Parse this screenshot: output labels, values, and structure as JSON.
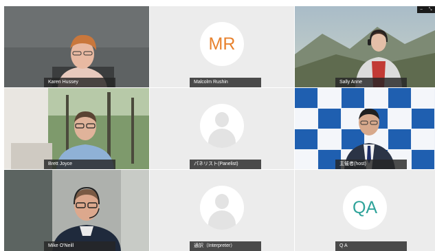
{
  "participants": [
    {
      "name": "Karen Hussey",
      "type": "video"
    },
    {
      "name": "Malcolm Rushin",
      "type": "initials",
      "initials": "MR",
      "initials_color": "#e8822e"
    },
    {
      "name": "Sally Anne",
      "type": "video"
    },
    {
      "name": "Brett Joyce",
      "type": "video"
    },
    {
      "name": "パネリスト(Panelist)",
      "type": "silhouette"
    },
    {
      "name": "主催者(host)",
      "type": "video"
    },
    {
      "name": "Mike O'Neill",
      "type": "video"
    },
    {
      "name": "通訳（Interpreter）",
      "type": "silhouette"
    },
    {
      "name": "Q A",
      "type": "initials",
      "initials": "QA",
      "initials_color": "#2fa39a"
    }
  ],
  "window_controls": {
    "minimize": "–",
    "expand": "⤡"
  },
  "colors": {
    "tile_background": "#ececec",
    "name_tag_background": "#262626",
    "host_backdrop_blue": "#1f5fb0"
  }
}
